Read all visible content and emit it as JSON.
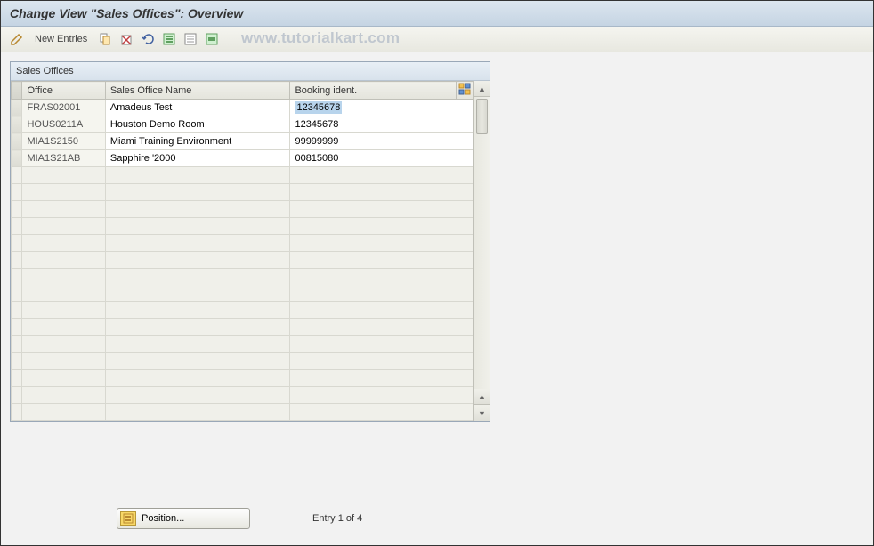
{
  "title": "Change View \"Sales Offices\": Overview",
  "watermark": "www.tutorialkart.com",
  "toolbar": {
    "new_entries_label": "New Entries"
  },
  "table": {
    "title": "Sales Offices",
    "columns": {
      "office": "Office",
      "name": "Sales Office Name",
      "booking": "Booking ident."
    },
    "rows": [
      {
        "office": "FRAS02001",
        "name": "Amadeus Test",
        "booking": "12345678",
        "selected": true
      },
      {
        "office": "HOUS0211A",
        "name": "Houston Demo Room",
        "booking": "12345678",
        "selected": false
      },
      {
        "office": "MIA1S2150",
        "name": "Miami Training Environment",
        "booking": "99999999",
        "selected": false
      },
      {
        "office": "MIA1S21AB",
        "name": "Sapphire '2000",
        "booking": "00815080",
        "selected": false
      }
    ],
    "empty_row_count": 15
  },
  "footer": {
    "position_label": "Position...",
    "entry_status": "Entry 1 of 4"
  }
}
